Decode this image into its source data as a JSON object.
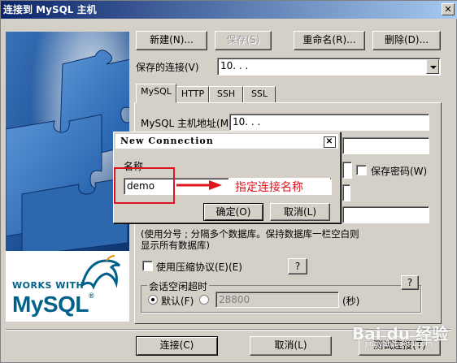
{
  "window": {
    "title": "连接到 MySQL 主机",
    "close_glyph": "✕"
  },
  "toolbar": {
    "new_label": "新建(N)...",
    "save_label": "保存(S)",
    "rename_label": "重命名(R)...",
    "delete_label": "删除(D)..."
  },
  "saved_connection": {
    "label": "保存的连接(V)",
    "value": "10.  .  .  "
  },
  "tabs": [
    "MySQL",
    "HTTP",
    "SSH",
    "SSL"
  ],
  "mysql_tab": {
    "host_label": "MySQL 主机地址(M)",
    "host_value": "10.  .  .  ",
    "save_password_label": "保存密码(W)",
    "databases_hint": "(使用分号 ; 分隔多个数据库。保持数据库一栏空白则\n显示所有数据库)",
    "compress_label": "使用压缩协议(E)(E)",
    "help_button": "?",
    "timeout_group_label": "会话空闲超时",
    "timeout_default_label": "默认(F)",
    "timeout_value": "28800",
    "timeout_unit": "(秒)"
  },
  "footer": {
    "connect_label": "连接(C)",
    "cancel_label": "取消(L)",
    "test_label": "测试连接(T)"
  },
  "logo": {
    "line1": "WORKS WITH",
    "line2": "MySQL",
    "trademark": "®"
  },
  "dialog": {
    "title": "New Connection",
    "close_glyph": "✕",
    "name_label": "名称",
    "name_value": "demo",
    "ok_label": "确定(O)",
    "cancel_label": "取消(L)"
  },
  "annotation": {
    "text": "指定连接名称",
    "color": "#e0141e"
  },
  "watermark": {
    "text": "Bai du 经验",
    "sub": "jingyan.baidu.com"
  },
  "colors": {
    "mysql_blue": "#00618a",
    "mysql_orange": "#e48e00",
    "title_blue": "#0a246a"
  }
}
